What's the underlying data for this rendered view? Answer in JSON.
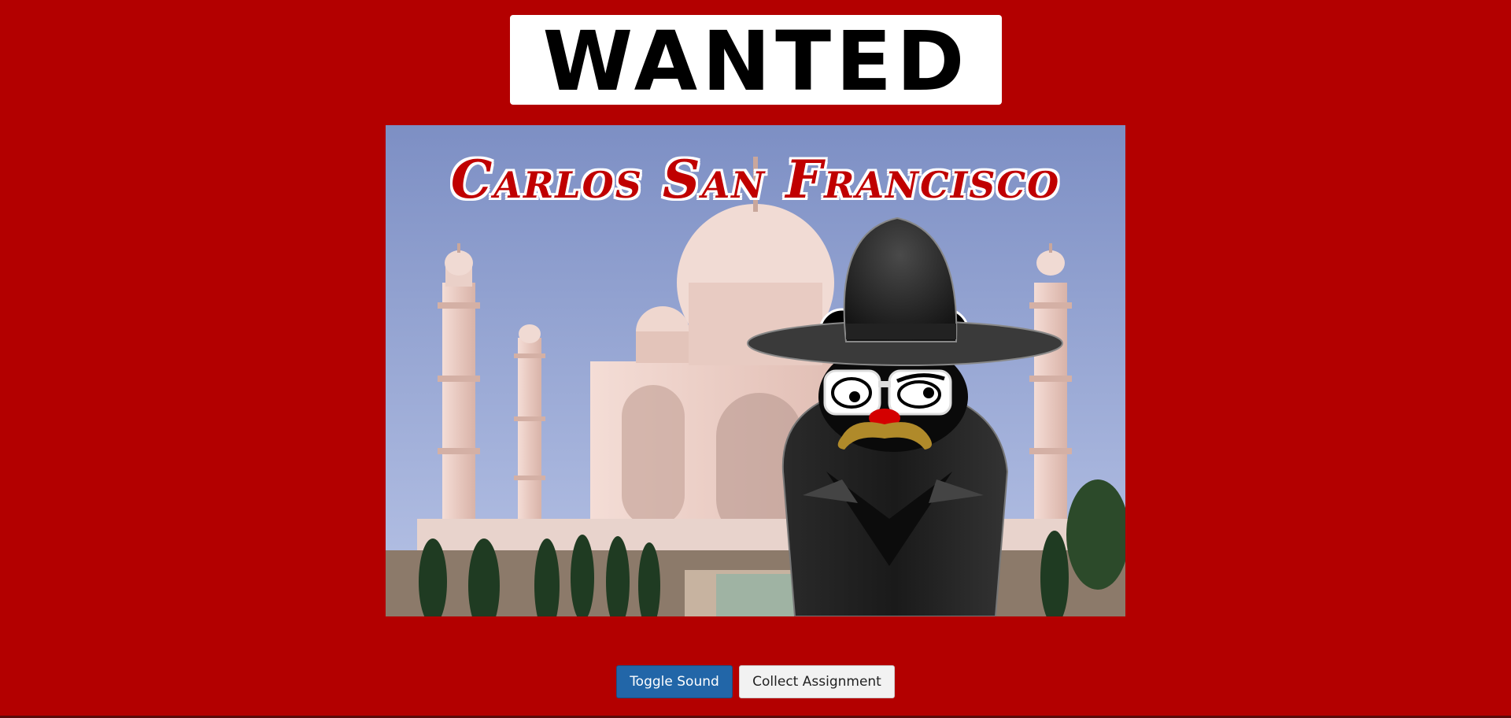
{
  "banner": {
    "title": "WANTED"
  },
  "poster": {
    "villain_name": "Carlos San Francisco"
  },
  "controls": {
    "toggle_sound_label": "Toggle Sound",
    "collect_assignment_label": "Collect Assignment"
  },
  "colors": {
    "background": "#b30000",
    "banner_bg": "#ffffff",
    "name_color": "#c00000",
    "primary_button": "#2266a8"
  }
}
